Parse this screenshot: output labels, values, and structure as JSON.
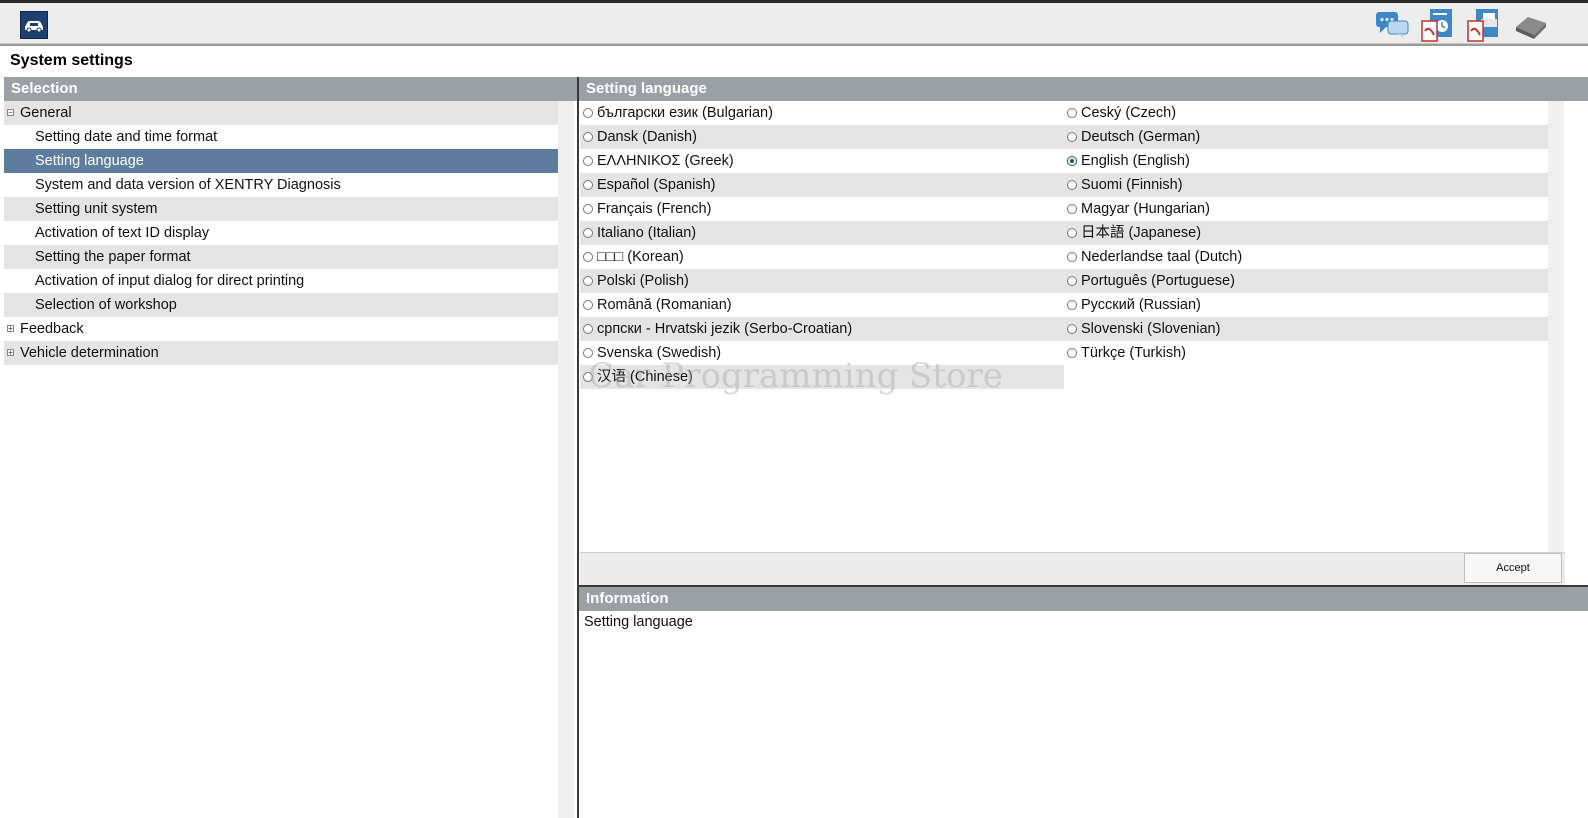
{
  "window": {
    "title": "System settings",
    "top_icons": [
      "car-home-icon",
      "chat-help-icon",
      "pdf-history-icon",
      "pdf-print-icon",
      "printer-icon"
    ]
  },
  "selection_panel": {
    "header": "Selection",
    "items": [
      {
        "label": "General",
        "level": 0,
        "expander": "minus"
      },
      {
        "label": "Setting date and time format",
        "level": 1
      },
      {
        "label": "Setting language",
        "level": 1,
        "selected": true
      },
      {
        "label": "System and data version of XENTRY Diagnosis",
        "level": 1
      },
      {
        "label": "Setting unit system",
        "level": 1
      },
      {
        "label": "Activation of text ID display",
        "level": 1
      },
      {
        "label": "Setting the paper format",
        "level": 1
      },
      {
        "label": "Activation of input dialog for direct printing",
        "level": 1
      },
      {
        "label": "Selection of workshop",
        "level": 1
      },
      {
        "label": "Feedback",
        "level": 0,
        "expander": "plus"
      },
      {
        "label": "Vehicle determination",
        "level": 0,
        "expander": "plus"
      }
    ]
  },
  "language_panel": {
    "header": "Setting language",
    "left_column": [
      "български език (Bulgarian)",
      "Dansk (Danish)",
      "ΕΛΛΗΝΙΚΟΣ (Greek)",
      "Español (Spanish)",
      "Français (French)",
      "Italiano (Italian)",
      "□□□ (Korean)",
      "Polski (Polish)",
      "Română (Romanian)",
      "српски - Hrvatski jezik (Serbo-Croatian)",
      "Svenska (Swedish)",
      "汉语 (Chinese)"
    ],
    "right_column": [
      "Ceský (Czech)",
      "Deutsch (German)",
      "English (English)",
      "Suomi (Finnish)",
      "Magyar (Hungarian)",
      "日本語 (Japanese)",
      "Nederlandse taal (Dutch)",
      "Português (Portuguese)",
      "Русский (Russian)",
      "Slovenski (Slovenian)",
      "Türkçe (Turkish)"
    ],
    "selected": "English (English)",
    "accept_label": "Accept"
  },
  "information_panel": {
    "header": "Information",
    "text": "Setting language"
  },
  "watermark": "Car Programming Store",
  "colors": {
    "header_bar": "#9aa0a6",
    "selected_row": "#5e7c9d",
    "alt_row": "#e4e4e4",
    "radio_checked": "#1d4f80"
  }
}
